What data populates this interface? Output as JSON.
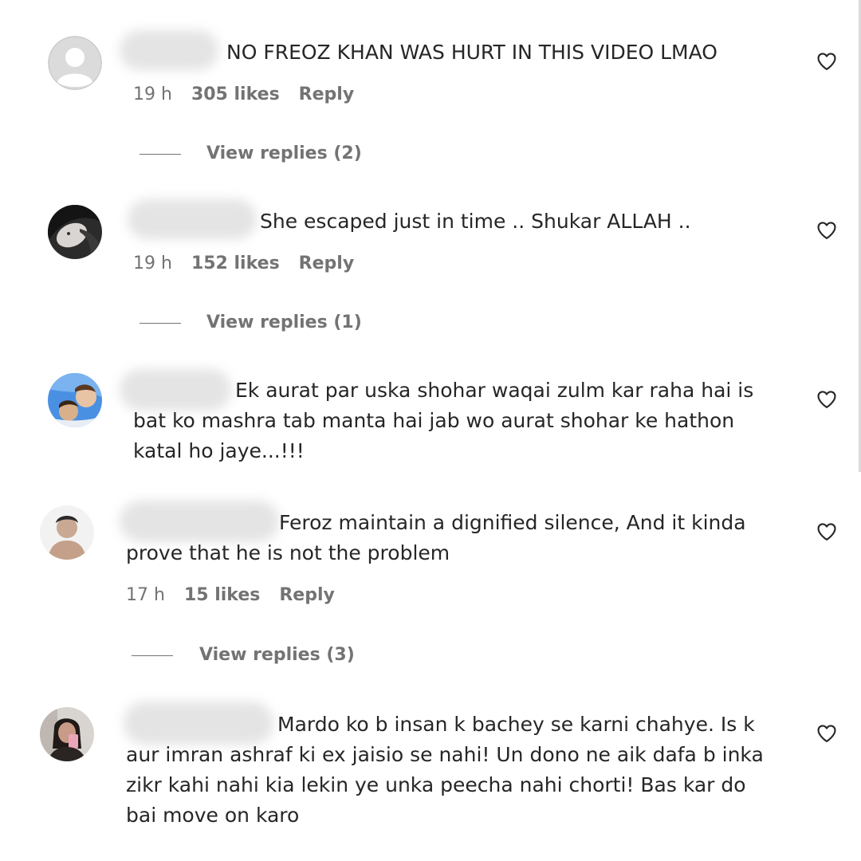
{
  "comments": [
    {
      "text": "NO FREOZ KHAN WAS HURT IN THIS VIDEO LMAO",
      "time": "19 h",
      "likes": "305 likes",
      "reply": "Reply",
      "view_replies": "View replies (2)",
      "avatar": "default-user-icon"
    },
    {
      "text": "She escaped just in time .. Shukar ALLAH ..",
      "time": "19 h",
      "likes": "152 likes",
      "reply": "Reply",
      "view_replies": "View replies (1)",
      "avatar": "profile-photo"
    },
    {
      "text_line1": "Ek aurat par uska shohar waqai zulm kar raha hai is",
      "text_line2": "bat ko mashra tab manta hai jab wo aurat shohar ke hathon",
      "text_line3": "katal ho jaye...!!!",
      "avatar": "profile-photo"
    },
    {
      "text_line1": "Feroz maintain a dignified silence, And it kinda",
      "text_line2": "prove that he is not the problem",
      "time": "17 h",
      "likes": "15 likes",
      "reply": "Reply",
      "view_replies": "View replies (3)",
      "avatar": "profile-photo"
    },
    {
      "text_line1": "Mardo ko b insan k bachey se karni chahye. Is k",
      "text_line2": "aur imran ashraf ki ex jaisio se nahi! Un dono ne aik dafa b inka",
      "text_line3": "zikr kahi nahi kia lekin ye unka peecha nahi chorti! Bas kar do",
      "text_line4": "bai move on karo",
      "avatar": "profile-photo"
    }
  ],
  "icons": {
    "like": "heart-outline-icon"
  },
  "colors": {
    "text": "#262626",
    "secondary": "#737373",
    "background": "#ffffff"
  }
}
